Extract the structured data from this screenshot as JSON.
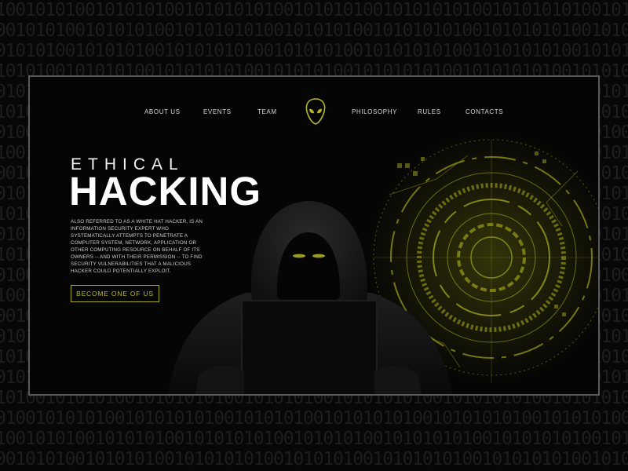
{
  "nav": {
    "items_left": [
      "ABOUT US",
      "EVENTS",
      "TEAM"
    ],
    "items_right": [
      "PHILOSOPHY",
      "RULES",
      "CONTACTS"
    ]
  },
  "hero": {
    "eyebrow": "ETHICAL",
    "headline": "HACKING",
    "description": "ALSO REFERRED TO AS A WHITE HAT HACKER, IS AN INFORMATION SECURITY EXPERT WHO SYSTEMATICALLY ATTEMPTS TO PENETRATE A COMPUTER SYSTEM, NETWORK, APPLICATION OR OTHER COMPUTING RESOURCE ON BEHALF OF ITS OWNERS -- AND WITH THEIR PERMISSION -- TO FIND SECURITY VULNERABILITIES THAT A MALICIOUS HACKER COULD POTENTIALLY EXPLOIT.",
    "cta_label": "BECOME ONE OF US"
  },
  "icons": {
    "logo": "alien-head-icon"
  },
  "colors": {
    "accent": "#b4b62a",
    "background": "#070707",
    "frame_border": "#5a5a5a",
    "binary_text": "#1e1e1e"
  },
  "binary_pattern": "1001010100101010100101010101001010101001010101010010101010100101010"
}
